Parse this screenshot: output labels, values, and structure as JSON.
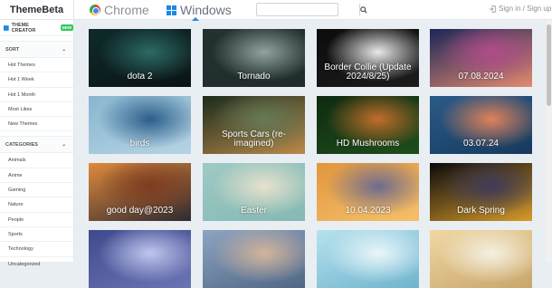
{
  "header": {
    "logo": "ThemeBeta",
    "tabs": [
      {
        "label": "Chrome",
        "icon": "chrome-icon"
      },
      {
        "label": "Windows",
        "icon": "windows-icon"
      }
    ],
    "search_placeholder": "",
    "signin": "Sign in / Sign up"
  },
  "sidebar": {
    "theme_creator": "THEME CREATOR",
    "new_badge": "NEW",
    "sort_title": "SORT",
    "sort_items": [
      "Hot Themes",
      "Hot 1 Week",
      "Hot 1 Month",
      "Most Likes",
      "New Themes"
    ],
    "categories_title": "CATEGORIES",
    "category_items": [
      "Animals",
      "Anime",
      "Gaming",
      "Nature",
      "People",
      "Sports",
      "Technology",
      "Uncategorized"
    ]
  },
  "themes": [
    {
      "label": "dota 2",
      "colors": [
        "#0f2a2a",
        "#2c6a63",
        "#0b1416"
      ]
    },
    {
      "label": "Tornado",
      "colors": [
        "#24322f",
        "#90a3a0",
        "#1f2c2c"
      ]
    },
    {
      "label": "Border Collie   (Update 2024/8/25)",
      "colors": [
        "#0c0c0c",
        "#e8e8e8",
        "#1c1c1c"
      ]
    },
    {
      "label": "07.08.2024",
      "colors": [
        "#1b2658",
        "#b14b8b",
        "#e48a6f"
      ]
    },
    {
      "label": "birds",
      "colors": [
        "#88b6cf",
        "#2b5e8a",
        "#b6d3e4"
      ]
    },
    {
      "label": "Sports Cars (re-imagined)",
      "colors": [
        "#1b2b1d",
        "#667a55",
        "#b88a4b"
      ]
    },
    {
      "label": "HD Mushrooms",
      "colors": [
        "#0f2a10",
        "#c26d2a",
        "#1e4e1c"
      ]
    },
    {
      "label": "03.07.24",
      "colors": [
        "#2a5b88",
        "#e0825a",
        "#173a5d"
      ]
    },
    {
      "label": "good day@2023",
      "colors": [
        "#e08a3b",
        "#7f3b1f",
        "#2e2a30"
      ]
    },
    {
      "label": "Easter",
      "colors": [
        "#9fc9c4",
        "#e7e1cc",
        "#84b9b3"
      ]
    },
    {
      "label": "10.04.2023",
      "colors": [
        "#e1963d",
        "#6d6b8f",
        "#f5c06b"
      ]
    },
    {
      "label": "Dark Spring",
      "colors": [
        "#0b0b0b",
        "#3f3a5a",
        "#d69b2b"
      ]
    },
    {
      "label": "",
      "colors": [
        "#3f4a8c",
        "#c0c7ef",
        "#6b74b5"
      ]
    },
    {
      "label": "",
      "colors": [
        "#8da4c2",
        "#d3b49b",
        "#4f6785"
      ]
    },
    {
      "label": "",
      "colors": [
        "#b7e2ef",
        "#e9f6fa",
        "#6fb4cd"
      ]
    },
    {
      "label": "",
      "colors": [
        "#f0d8a4",
        "#f5f0e3",
        "#c9a66a"
      ]
    }
  ]
}
